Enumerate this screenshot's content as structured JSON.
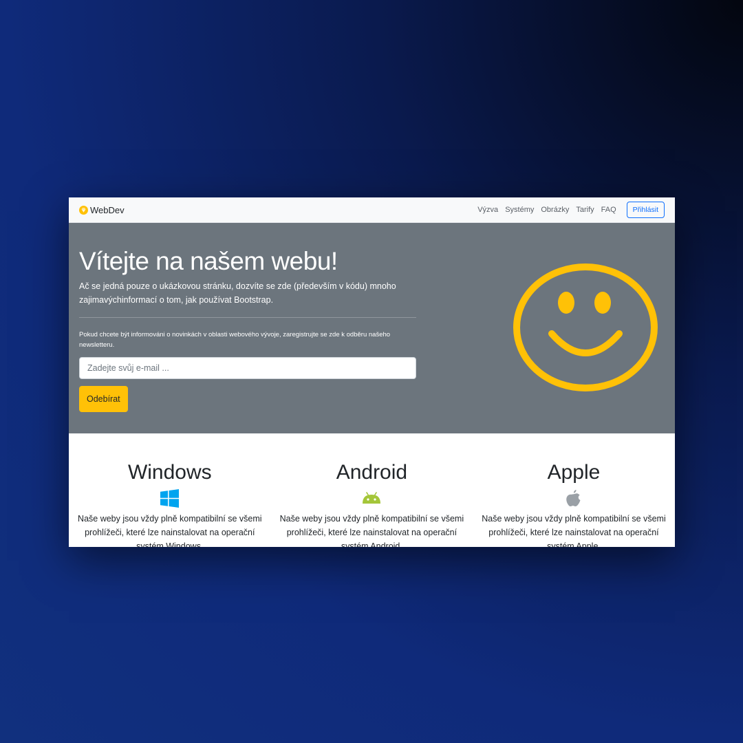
{
  "navbar": {
    "brand": "WebDev",
    "links": [
      "Výzva",
      "Systémy",
      "Obrázky",
      "Tarify",
      "FAQ"
    ],
    "login_label": "Přihlásit"
  },
  "hero": {
    "title": "Vítejte na našem webu!",
    "lead": "Ač se jedná pouze o ukázkovou stránku, dozvíte se zde (především v kódu) mnoho zajimavýchinformací o tom, jak používat Bootstrap.",
    "newsletter_text": "Pokud chcete být informováni o novinkách v oblasti webového vývoje, zaregistrujte se zde k odběru našeho newsletteru.",
    "email_placeholder": "Zadejte svůj e-mail ...",
    "subscribe_label": "Odebírat",
    "smiley_color": "#ffc107",
    "background_color": "#6c757d"
  },
  "features": [
    {
      "title": "Windows",
      "icon": "windows-icon",
      "text": "Naše weby jsou vždy plně kompatibilní se všemi prohlížeči, které lze nainstalovat na operační systém Windows."
    },
    {
      "title": "Android",
      "icon": "android-icon",
      "text": "Naše weby jsou vždy plně kompatibilní se všemi prohlížeči, které lze nainstalovat na operační systém Android."
    },
    {
      "title": "Apple",
      "icon": "apple-icon",
      "text": "Naše weby jsou vždy plně kompatibilní se všemi prohlížeči, které lze nainstalovat na operační systém Apple."
    }
  ],
  "colors": {
    "accent_blue": "#0d6efd",
    "warning_yellow": "#ffc107",
    "windows_blue": "#00a4ef",
    "android_green": "#a4c639",
    "apple_gray": "#9aa0a6"
  }
}
